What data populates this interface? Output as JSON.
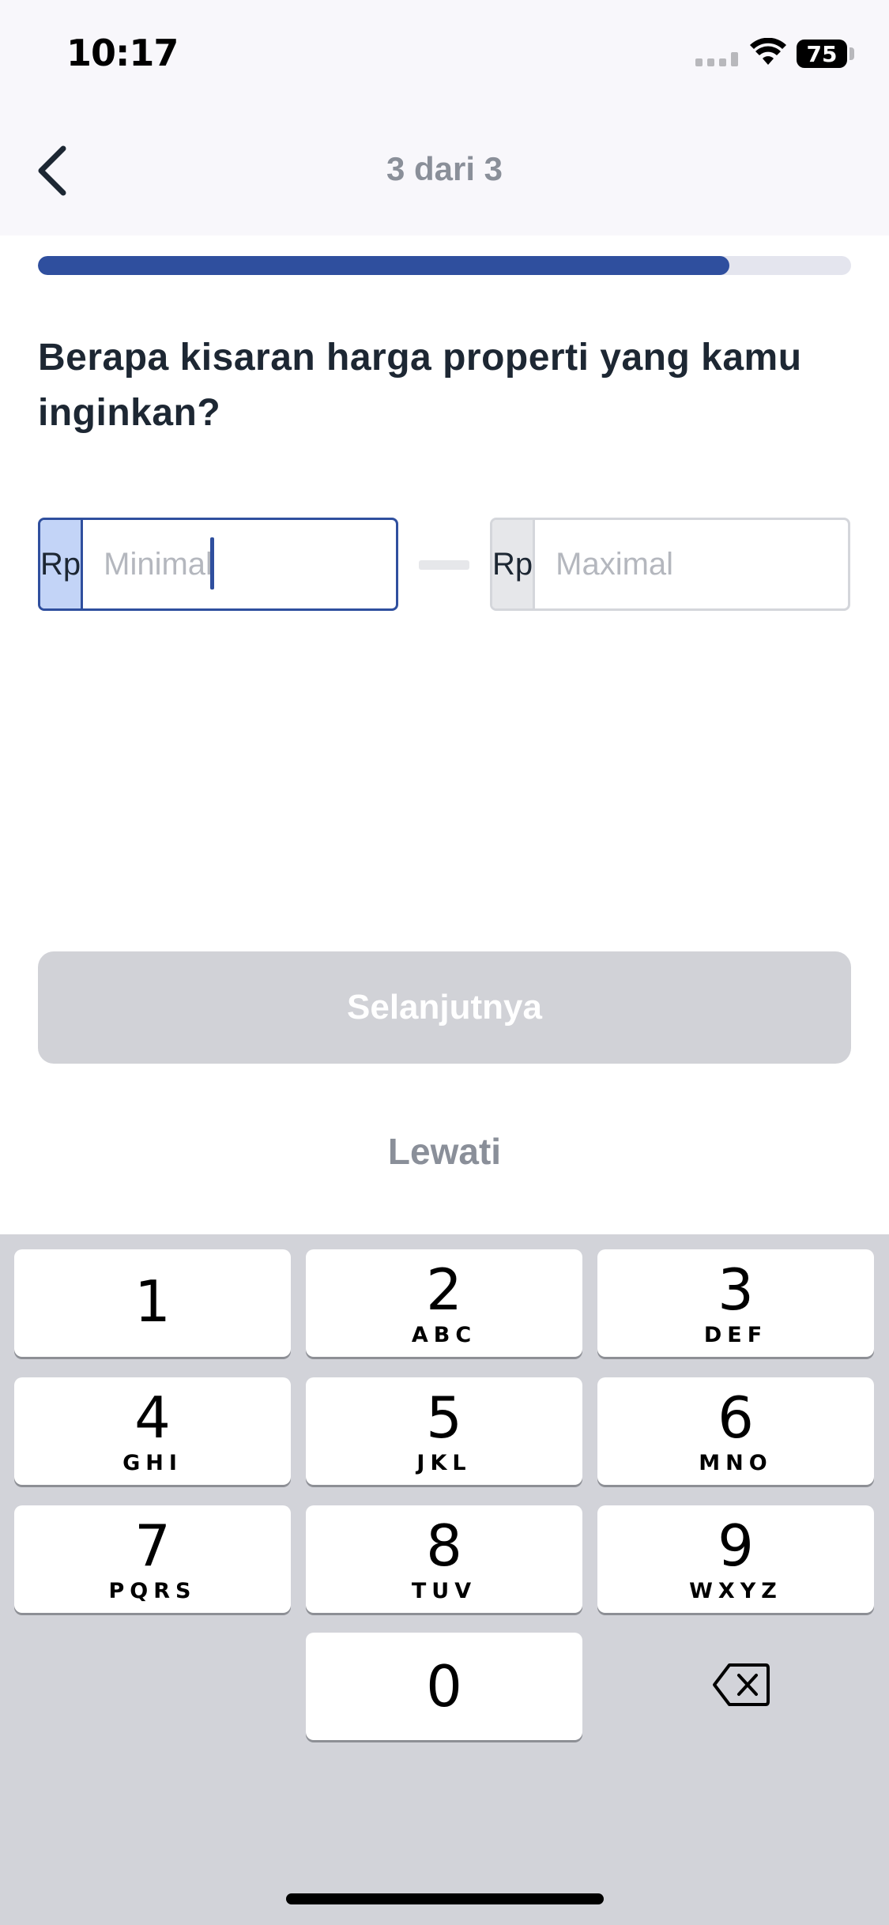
{
  "status_bar": {
    "time": "10:17",
    "battery": "75",
    "icons": [
      "cellular-signal-icon",
      "wifi-icon",
      "battery-icon"
    ]
  },
  "header": {
    "step_label": "3 dari 3",
    "back_icon": "chevron-left-icon"
  },
  "progress": {
    "fraction": 0.85
  },
  "question": "Berapa kisaran harga properti yang kamu inginkan?",
  "price_range": {
    "min": {
      "prefix": "Rp",
      "placeholder": "Minimal",
      "value": ""
    },
    "max": {
      "prefix": "Rp",
      "placeholder": "Maximal",
      "value": ""
    }
  },
  "actions": {
    "next_label": "Selanjutnya",
    "skip_label": "Lewati"
  },
  "keyboard": {
    "keys": [
      {
        "num": "1",
        "letters": ""
      },
      {
        "num": "2",
        "letters": "ABC"
      },
      {
        "num": "3",
        "letters": "DEF"
      },
      {
        "num": "4",
        "letters": "GHI"
      },
      {
        "num": "5",
        "letters": "JKL"
      },
      {
        "num": "6",
        "letters": "MNO"
      },
      {
        "num": "7",
        "letters": "PQRS"
      },
      {
        "num": "8",
        "letters": "TUV"
      },
      {
        "num": "9",
        "letters": "WXYZ"
      },
      {
        "num": "0",
        "letters": ""
      }
    ],
    "delete_icon": "backspace-icon"
  },
  "colors": {
    "accent": "#2f4f9e",
    "disabled_button": "#d1d2d7",
    "prefix_active": "#c3d4f7",
    "muted_text": "#8a8f99"
  }
}
